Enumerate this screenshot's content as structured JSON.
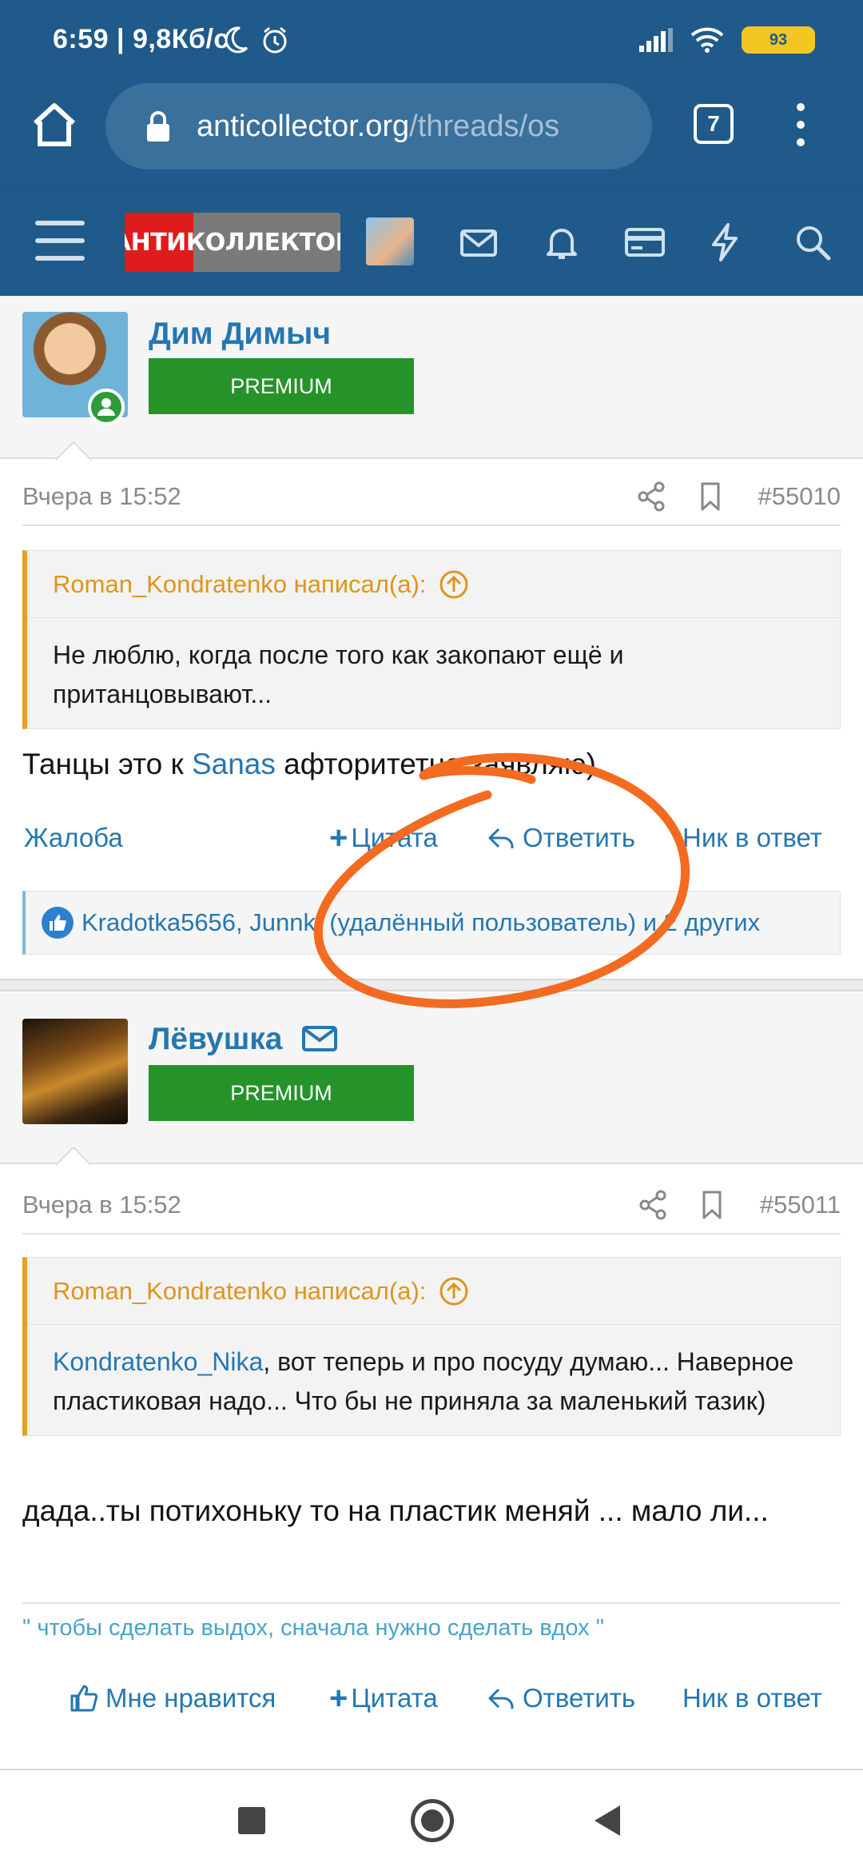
{
  "status_bar": {
    "time": "6:59 | 9,8Кб/с",
    "battery": "93"
  },
  "browser": {
    "url_host": "anticollector.org",
    "url_path": "/threads/os",
    "tab_count": "7"
  },
  "site": {
    "logo_text": "АНТИКОЛЛЕКТОР"
  },
  "posts": [
    {
      "username": "Дим Димыч",
      "badge": "PREMIUM",
      "date": "Вчера в 15:52",
      "post_number": "#55010",
      "quote_author": "Roman_Kondratenko написал(а):",
      "quote_text": "Не люблю, когда после того как закопают ещё и пританцовывают...",
      "text_before": "Танцы это к ",
      "text_link": "Sanas",
      "text_after": " афторитетно заявляю)",
      "actions": {
        "report": "Жалоба",
        "quote": "Цитата",
        "reply": "Ответить",
        "nick": "Ник в ответ"
      },
      "likes": "Kradotka5656, Junnk, (удалённый пользователь) и 2 других"
    },
    {
      "username": "Лёвушка",
      "badge": "PREMIUM",
      "date": "Вчера в 15:52",
      "post_number": "#55011",
      "quote_author": "Roman_Kondratenko написал(а):",
      "quote_link": "Kondratenko_Nika",
      "quote_text": ", вот теперь и про посуду думаю... Наверное пластиковая надо... Что бы не приняла за маленький тазик)",
      "text": "дада..ты потихоньку то на пластик меняй ... мало ли...",
      "signature": "\" чтобы сделать выдох, сначала нужно сделать вдох \"",
      "actions": {
        "like": "Мне нравится",
        "quote": "Цитата",
        "reply": "Ответить",
        "nick": "Ник в ответ"
      }
    }
  ],
  "colors": {
    "header": "#1f5a8a",
    "link": "#2577b1",
    "premium": "#25932a",
    "quote_accent": "#e8a020",
    "annotation": "#f26b21"
  }
}
